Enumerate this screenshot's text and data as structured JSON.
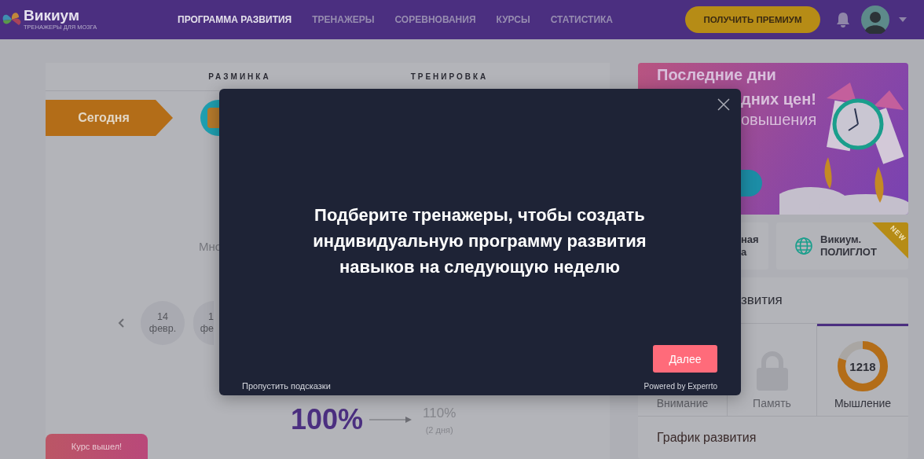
{
  "header": {
    "logo": {
      "name": "Викиум",
      "tagline": "ТРЕНАЖЕРЫ ДЛЯ МОЗГА"
    },
    "nav": [
      {
        "label": "ПРОГРАММА РАЗВИТИЯ",
        "selected": true
      },
      {
        "label": "ТРЕНАЖЕРЫ",
        "selected": false
      },
      {
        "label": "СОРЕВНОВАНИЯ",
        "selected": false
      },
      {
        "label": "КУРСЫ",
        "selected": false
      },
      {
        "label": "СТАТИСТИКА",
        "selected": false
      }
    ],
    "premium_button": "ПОЛУЧИТЬ ПРЕМИУМ"
  },
  "plan": {
    "columns": [
      "РАЗМИНКА",
      "ТРЕНИРОВКА"
    ],
    "today_label": "Сегодня",
    "text_fragment": "Мно",
    "dates": [
      {
        "day": "14",
        "month": "февр."
      },
      {
        "day": "1",
        "month": "фе"
      }
    ],
    "progress": {
      "current": "100%",
      "next": "110%",
      "note": "(2 дня)"
    }
  },
  "toast": "Курс вышел!",
  "promo": {
    "lines": [
      "Последние дни",
      "дних цен!",
      "овышения"
    ]
  },
  "cards": [
    {
      "lines": [
        "ная",
        "а"
      ],
      "kind": "plain"
    },
    {
      "lines": [
        "Викиум.",
        "ПОЛИГЛОТ"
      ],
      "kind": "globe",
      "badge": "NEW"
    }
  ],
  "skills": {
    "title": "звития",
    "tabs": [
      {
        "label": "Внимание",
        "selected": false,
        "kind": "covered"
      },
      {
        "label": "Память",
        "selected": false,
        "kind": "locked"
      },
      {
        "label": "Мышление",
        "selected": true,
        "kind": "score",
        "score": "1218",
        "level": 0.8
      }
    ],
    "chart_title": "График развития"
  },
  "modal": {
    "message": "Подберите тренажеры, чтобы создать индивидуальную программу развития навыков на следующую неделю",
    "next_button": "Далее",
    "skip_link": "Пропустить подсказки",
    "powered_by": "Powered by Experrto"
  }
}
